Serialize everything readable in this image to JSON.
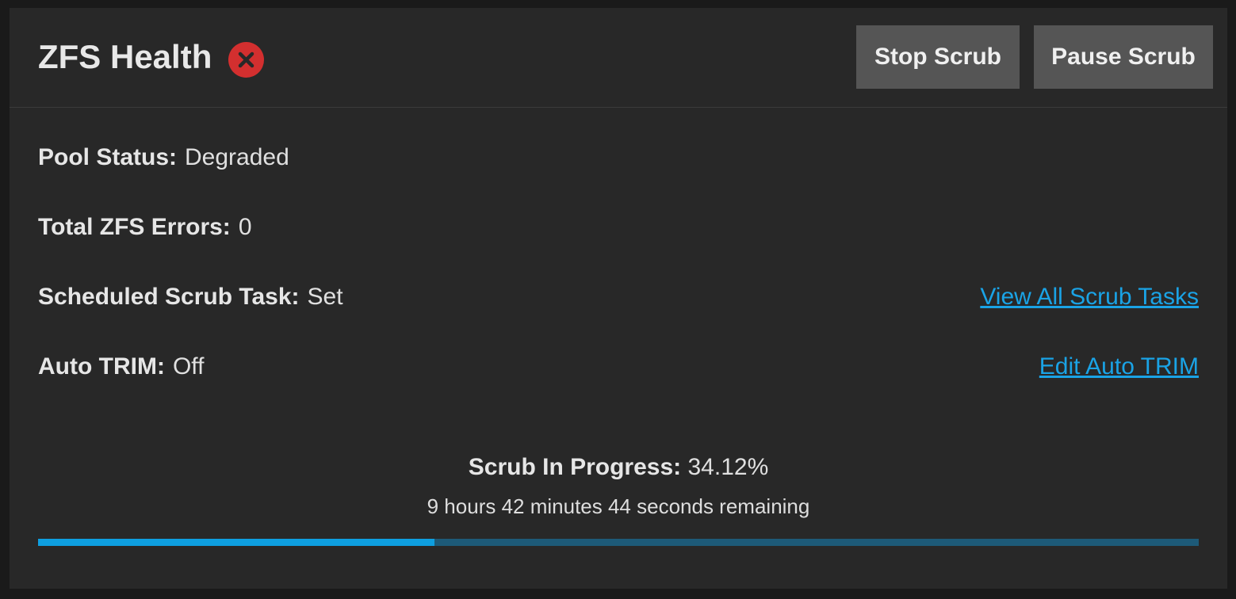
{
  "widget": {
    "title": "ZFS Health",
    "status_icon": "error-circle-x-icon",
    "status_color": "#d32f2f"
  },
  "toolbar": {
    "stop_label": "Stop Scrub",
    "pause_label": "Pause Scrub"
  },
  "details": {
    "pool_status_label": "Pool Status:",
    "pool_status_value": "Degraded",
    "errors_label": "Total ZFS Errors:",
    "errors_value": "0",
    "scrub_task_label": "Scheduled Scrub Task:",
    "scrub_task_value": "Set",
    "auto_trim_label": "Auto TRIM:",
    "auto_trim_value": "Off"
  },
  "links": {
    "view_scrub_tasks": "View All Scrub Tasks",
    "edit_auto_trim": "Edit Auto TRIM"
  },
  "progress": {
    "label": "Scrub In Progress:",
    "percent_text": "34.12%",
    "percent": 34.12,
    "remaining": "9 hours 42 minutes 44 seconds remaining",
    "fill_color": "#0e9fe0",
    "track_color": "#1d5a78"
  },
  "colors": {
    "card_bg": "#282828",
    "button_bg": "#555555",
    "link": "#1aa3e6"
  }
}
